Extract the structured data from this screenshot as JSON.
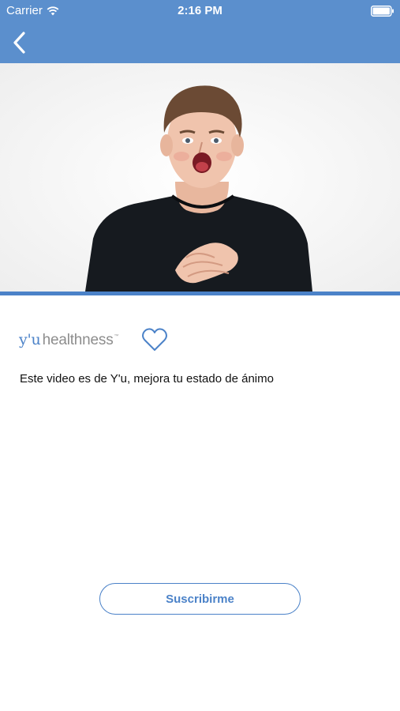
{
  "status_bar": {
    "carrier": "Carrier",
    "time": "2:16 PM",
    "wifi_icon": "wifi-icon",
    "battery_icon": "battery-icon"
  },
  "nav": {
    "back_icon": "chevron-left-icon"
  },
  "video": {
    "description": "video still of a young man with open mouth and crossed hands on chest"
  },
  "brand": {
    "logo_yu": "y'u",
    "logo_text": "healthness",
    "logo_tm": "™",
    "favorite_icon": "heart-outline-icon"
  },
  "content": {
    "description": "Este video es de Y'u, mejora tu estado de ánimo"
  },
  "actions": {
    "subscribe_label": "Suscribirme"
  },
  "colors": {
    "header": "#5b8fcd",
    "accent": "#4b82c8",
    "text": "#111111"
  }
}
